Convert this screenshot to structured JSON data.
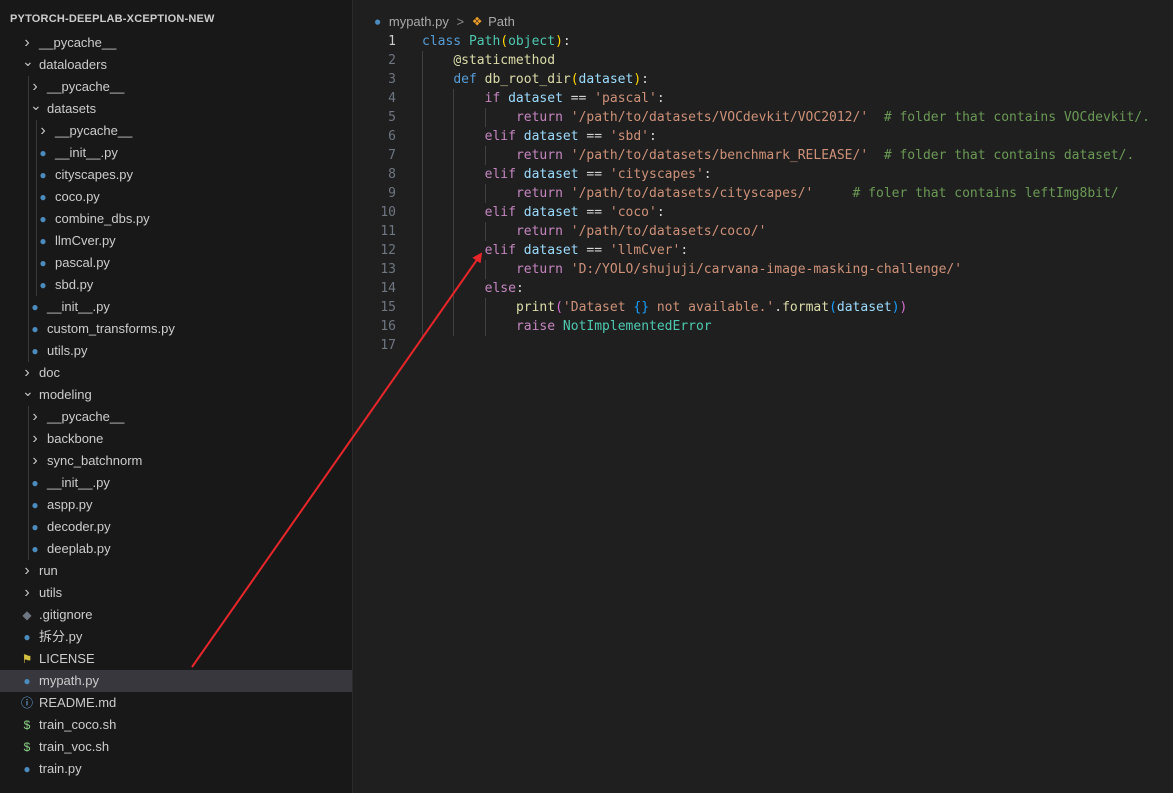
{
  "explorer": {
    "title": "PYTORCH-DEEPLAB-XCEPTION-NEW",
    "items": [
      {
        "label": "__pycache__",
        "type": "folder",
        "expanded": false,
        "depth": 1,
        "icon": "chevron-right-icon"
      },
      {
        "label": "dataloaders",
        "type": "folder",
        "expanded": true,
        "depth": 1,
        "icon": "chevron-down-icon"
      },
      {
        "label": "__pycache__",
        "type": "folder",
        "expanded": false,
        "depth": 2,
        "icon": "chevron-right-icon"
      },
      {
        "label": "datasets",
        "type": "folder",
        "expanded": true,
        "depth": 2,
        "icon": "chevron-down-icon"
      },
      {
        "label": "__pycache__",
        "type": "folder",
        "expanded": false,
        "depth": 3,
        "icon": "chevron-right-icon"
      },
      {
        "label": "__init__.py",
        "type": "python",
        "depth": 3,
        "icon": "python-icon"
      },
      {
        "label": "cityscapes.py",
        "type": "python",
        "depth": 3,
        "icon": "python-icon"
      },
      {
        "label": "coco.py",
        "type": "python",
        "depth": 3,
        "icon": "python-icon"
      },
      {
        "label": "combine_dbs.py",
        "type": "python",
        "depth": 3,
        "icon": "python-icon"
      },
      {
        "label": "llmCver.py",
        "type": "python",
        "depth": 3,
        "icon": "python-icon"
      },
      {
        "label": "pascal.py",
        "type": "python",
        "depth": 3,
        "icon": "python-icon"
      },
      {
        "label": "sbd.py",
        "type": "python",
        "depth": 3,
        "icon": "python-icon"
      },
      {
        "label": "__init__.py",
        "type": "python",
        "depth": 2,
        "icon": "python-icon"
      },
      {
        "label": "custom_transforms.py",
        "type": "python",
        "depth": 2,
        "icon": "python-icon"
      },
      {
        "label": "utils.py",
        "type": "python",
        "depth": 2,
        "icon": "python-icon"
      },
      {
        "label": "doc",
        "type": "folder",
        "expanded": false,
        "depth": 1,
        "icon": "chevron-right-icon"
      },
      {
        "label": "modeling",
        "type": "folder",
        "expanded": true,
        "depth": 1,
        "icon": "chevron-down-icon"
      },
      {
        "label": "__pycache__",
        "type": "folder",
        "expanded": false,
        "depth": 2,
        "icon": "chevron-right-icon"
      },
      {
        "label": "backbone",
        "type": "folder",
        "expanded": false,
        "depth": 2,
        "icon": "chevron-right-icon"
      },
      {
        "label": "sync_batchnorm",
        "type": "folder",
        "expanded": false,
        "depth": 2,
        "icon": "chevron-right-icon"
      },
      {
        "label": "__init__.py",
        "type": "python",
        "depth": 2,
        "icon": "python-icon"
      },
      {
        "label": "aspp.py",
        "type": "python",
        "depth": 2,
        "icon": "python-icon"
      },
      {
        "label": "decoder.py",
        "type": "python",
        "depth": 2,
        "icon": "python-icon"
      },
      {
        "label": "deeplab.py",
        "type": "python",
        "depth": 2,
        "icon": "python-icon"
      },
      {
        "label": "run",
        "type": "folder",
        "expanded": false,
        "depth": 1,
        "icon": "chevron-right-icon"
      },
      {
        "label": "utils",
        "type": "folder",
        "expanded": false,
        "depth": 1,
        "icon": "chevron-right-icon"
      },
      {
        "label": ".gitignore",
        "type": "git",
        "depth": 1,
        "icon": "git-icon"
      },
      {
        "label": "拆分.py",
        "type": "python",
        "depth": 1,
        "icon": "python-icon"
      },
      {
        "label": "LICENSE",
        "type": "license",
        "depth": 1,
        "icon": "license-icon"
      },
      {
        "label": "mypath.py",
        "type": "python",
        "depth": 1,
        "icon": "python-icon",
        "selected": true
      },
      {
        "label": "README.md",
        "type": "info",
        "depth": 1,
        "icon": "info-icon"
      },
      {
        "label": "train_coco.sh",
        "type": "shell",
        "depth": 1,
        "icon": "dollar-icon"
      },
      {
        "label": "train_voc.sh",
        "type": "shell",
        "depth": 1,
        "icon": "dollar-icon"
      },
      {
        "label": "train.py",
        "type": "python",
        "depth": 1,
        "icon": "python-icon"
      }
    ]
  },
  "breadcrumb": {
    "file": "mypath.py",
    "separator": ">",
    "symbol": "Path"
  },
  "editor": {
    "active_line": 1,
    "lines": [
      {
        "n": "1",
        "indent": 0,
        "tokens": [
          [
            "kw",
            "class "
          ],
          [
            "cls",
            "Path"
          ],
          [
            "br1",
            "("
          ],
          [
            "cls",
            "object"
          ],
          [
            "br1",
            ")"
          ],
          [
            "op",
            ":"
          ]
        ]
      },
      {
        "n": "2",
        "indent": 1,
        "tokens": [
          [
            "fn",
            "@staticmethod"
          ]
        ]
      },
      {
        "n": "3",
        "indent": 1,
        "tokens": [
          [
            "kw",
            "def "
          ],
          [
            "fn",
            "db_root_dir"
          ],
          [
            "br1",
            "("
          ],
          [
            "var",
            "dataset"
          ],
          [
            "br1",
            ")"
          ],
          [
            "op",
            ":"
          ]
        ]
      },
      {
        "n": "4",
        "indent": 2,
        "tokens": [
          [
            "ctl",
            "if "
          ],
          [
            "var",
            "dataset"
          ],
          [
            "op",
            " == "
          ],
          [
            "str",
            "'pascal'"
          ],
          [
            "op",
            ":"
          ]
        ]
      },
      {
        "n": "5",
        "indent": 3,
        "tokens": [
          [
            "ctl",
            "return "
          ],
          [
            "str",
            "'/path/to/datasets/VOCdevkit/VOC2012/'"
          ],
          [
            "op",
            "  "
          ],
          [
            "cm",
            "# folder that contains VOCdevkit/."
          ]
        ]
      },
      {
        "n": "6",
        "indent": 2,
        "tokens": [
          [
            "ctl",
            "elif "
          ],
          [
            "var",
            "dataset"
          ],
          [
            "op",
            " == "
          ],
          [
            "str",
            "'sbd'"
          ],
          [
            "op",
            ":"
          ]
        ]
      },
      {
        "n": "7",
        "indent": 3,
        "tokens": [
          [
            "ctl",
            "return "
          ],
          [
            "str",
            "'/path/to/datasets/benchmark_RELEASE/'"
          ],
          [
            "op",
            "  "
          ],
          [
            "cm",
            "# folder that contains dataset/."
          ]
        ]
      },
      {
        "n": "8",
        "indent": 2,
        "tokens": [
          [
            "ctl",
            "elif "
          ],
          [
            "var",
            "dataset"
          ],
          [
            "op",
            " == "
          ],
          [
            "str",
            "'cityscapes'"
          ],
          [
            "op",
            ":"
          ]
        ]
      },
      {
        "n": "9",
        "indent": 3,
        "tokens": [
          [
            "ctl",
            "return "
          ],
          [
            "str",
            "'/path/to/datasets/cityscapes/'"
          ],
          [
            "op",
            "     "
          ],
          [
            "cm",
            "# foler that contains leftImg8bit/"
          ]
        ]
      },
      {
        "n": "10",
        "indent": 2,
        "tokens": [
          [
            "ctl",
            "elif "
          ],
          [
            "var",
            "dataset"
          ],
          [
            "op",
            " == "
          ],
          [
            "str",
            "'coco'"
          ],
          [
            "op",
            ":"
          ]
        ]
      },
      {
        "n": "11",
        "indent": 3,
        "tokens": [
          [
            "ctl",
            "return "
          ],
          [
            "str",
            "'/path/to/datasets/coco/'"
          ]
        ]
      },
      {
        "n": "12",
        "indent": 2,
        "tokens": [
          [
            "ctl",
            "elif "
          ],
          [
            "var",
            "dataset"
          ],
          [
            "op",
            " == "
          ],
          [
            "str",
            "'llmCver'"
          ],
          [
            "op",
            ":"
          ]
        ]
      },
      {
        "n": "13",
        "indent": 3,
        "tokens": [
          [
            "ctl",
            "return "
          ],
          [
            "str",
            "'D:/YOLO/shujuji/carvana-image-masking-challenge/'"
          ]
        ]
      },
      {
        "n": "14",
        "indent": 2,
        "tokens": [
          [
            "ctl",
            "else"
          ],
          [
            "op",
            ":"
          ]
        ]
      },
      {
        "n": "15",
        "indent": 3,
        "tokens": [
          [
            "fn",
            "print"
          ],
          [
            "br2",
            "("
          ],
          [
            "str",
            "'Dataset "
          ],
          [
            "br3",
            "{}"
          ],
          [
            "str",
            " not available.'"
          ],
          [
            "op",
            "."
          ],
          [
            "fn",
            "format"
          ],
          [
            "br3",
            "("
          ],
          [
            "var",
            "dataset"
          ],
          [
            "br3",
            ")"
          ],
          [
            "br2",
            ")"
          ]
        ]
      },
      {
        "n": "16",
        "indent": 3,
        "tokens": [
          [
            "ctl",
            "raise "
          ],
          [
            "cls",
            "NotImplementedError"
          ]
        ]
      },
      {
        "n": "17",
        "indent": 0,
        "tokens": []
      }
    ]
  },
  "colors": {
    "annotation_arrow": "#e8262a",
    "python_icon": "#4b8bbe",
    "shell_icon": "#89d185",
    "license_icon": "#d4c13f",
    "info_icon": "#75beff"
  }
}
